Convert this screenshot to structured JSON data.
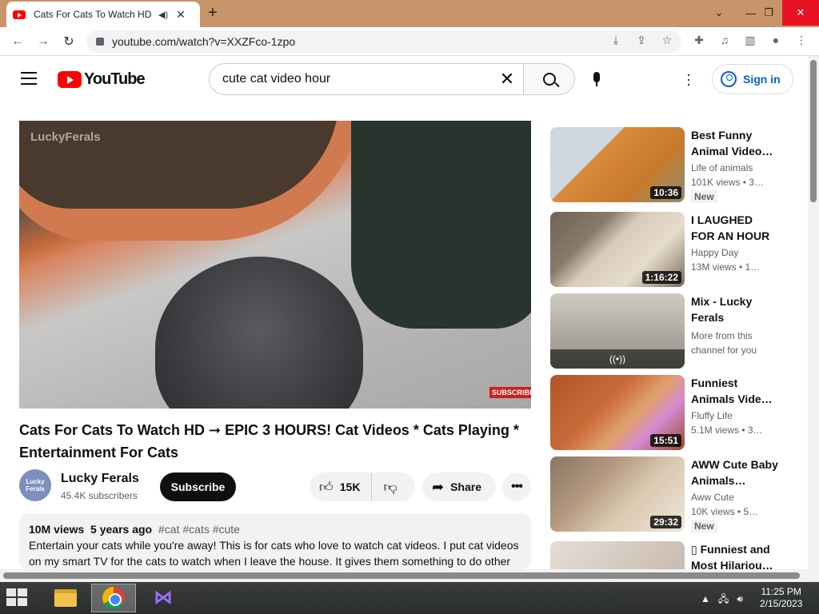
{
  "browser": {
    "tab_title": "Cats For Cats To Watch HD –",
    "url": "youtube.com/watch?v=XXZFco-1zpo",
    "new_tab_glyph": "+"
  },
  "youtube": {
    "logo_text": "YouTube",
    "search_query": "cute cat video hour",
    "sign_in": "Sign in"
  },
  "video": {
    "watermark": "LuckyFerals",
    "subscribe_watermark": "SUBSCRIBE",
    "title": "Cats For Cats To Watch HD ➞ EPIC 3 HOURS! Cat Videos * Cats Playing * Entertainment For Cats",
    "channel": "Lucky Ferals",
    "channel_avatar_text": "Lucky Ferals",
    "subscribers": "45.4K subscribers",
    "subscribe_label": "Subscribe",
    "likes": "15K",
    "share_label": "Share",
    "more_label": "•••",
    "views": "10M views",
    "age": "5 years ago",
    "tags": "#cat #cats #cute",
    "description": "Entertain your cats while you're away! This is for cats who love to watch cat videos. I put cat videos on my smart TV for the cats to watch when I leave the house. It gives them something to do other"
  },
  "recommendations": [
    {
      "title": "Best Funny Animal Video…",
      "channel": "Life of animals",
      "views": "101K views  • 3…",
      "duration": "10:36",
      "badge": "New",
      "thumb_colors": [
        "#cfd7df",
        "#d98a3a"
      ]
    },
    {
      "title": "I LAUGHED FOR AN HOUR😹…",
      "channel": "Happy Day",
      "views": "13M views  • 1…",
      "duration": "1:16:22",
      "badge": "",
      "thumb_colors": [
        "#8a7a6a",
        "#d8cbb8"
      ]
    },
    {
      "title": "Mix - Lucky Ferals",
      "channel": "More from this channel for you",
      "views": "",
      "duration": "",
      "badge": "",
      "live_symbol": "((•))",
      "thumb_colors": [
        "#8e8a84",
        "#c9c4bb"
      ]
    },
    {
      "title": "Funniest Animals Vide…",
      "channel": "Fluffy Life",
      "views": "5.1M views  • 3…",
      "duration": "15:51",
      "badge": "",
      "thumb_colors": [
        "#b1562a",
        "#e2a070"
      ]
    },
    {
      "title": "AWW Cute Baby Animals…",
      "channel": "Aww Cute",
      "views": "10K views  • 5…",
      "duration": "29:32",
      "badge": "New",
      "thumb_colors": [
        "#d9c8b0",
        "#8a7562"
      ]
    },
    {
      "title": "▯ Funniest and Most Hilariou…",
      "channel": "",
      "views": "",
      "duration": "",
      "badge": "",
      "thumb_colors": [
        "#e6ddd5",
        "#c0b2a6"
      ]
    }
  ],
  "taskbar": {
    "time": "11:25 PM",
    "date": "2/15/2023"
  }
}
